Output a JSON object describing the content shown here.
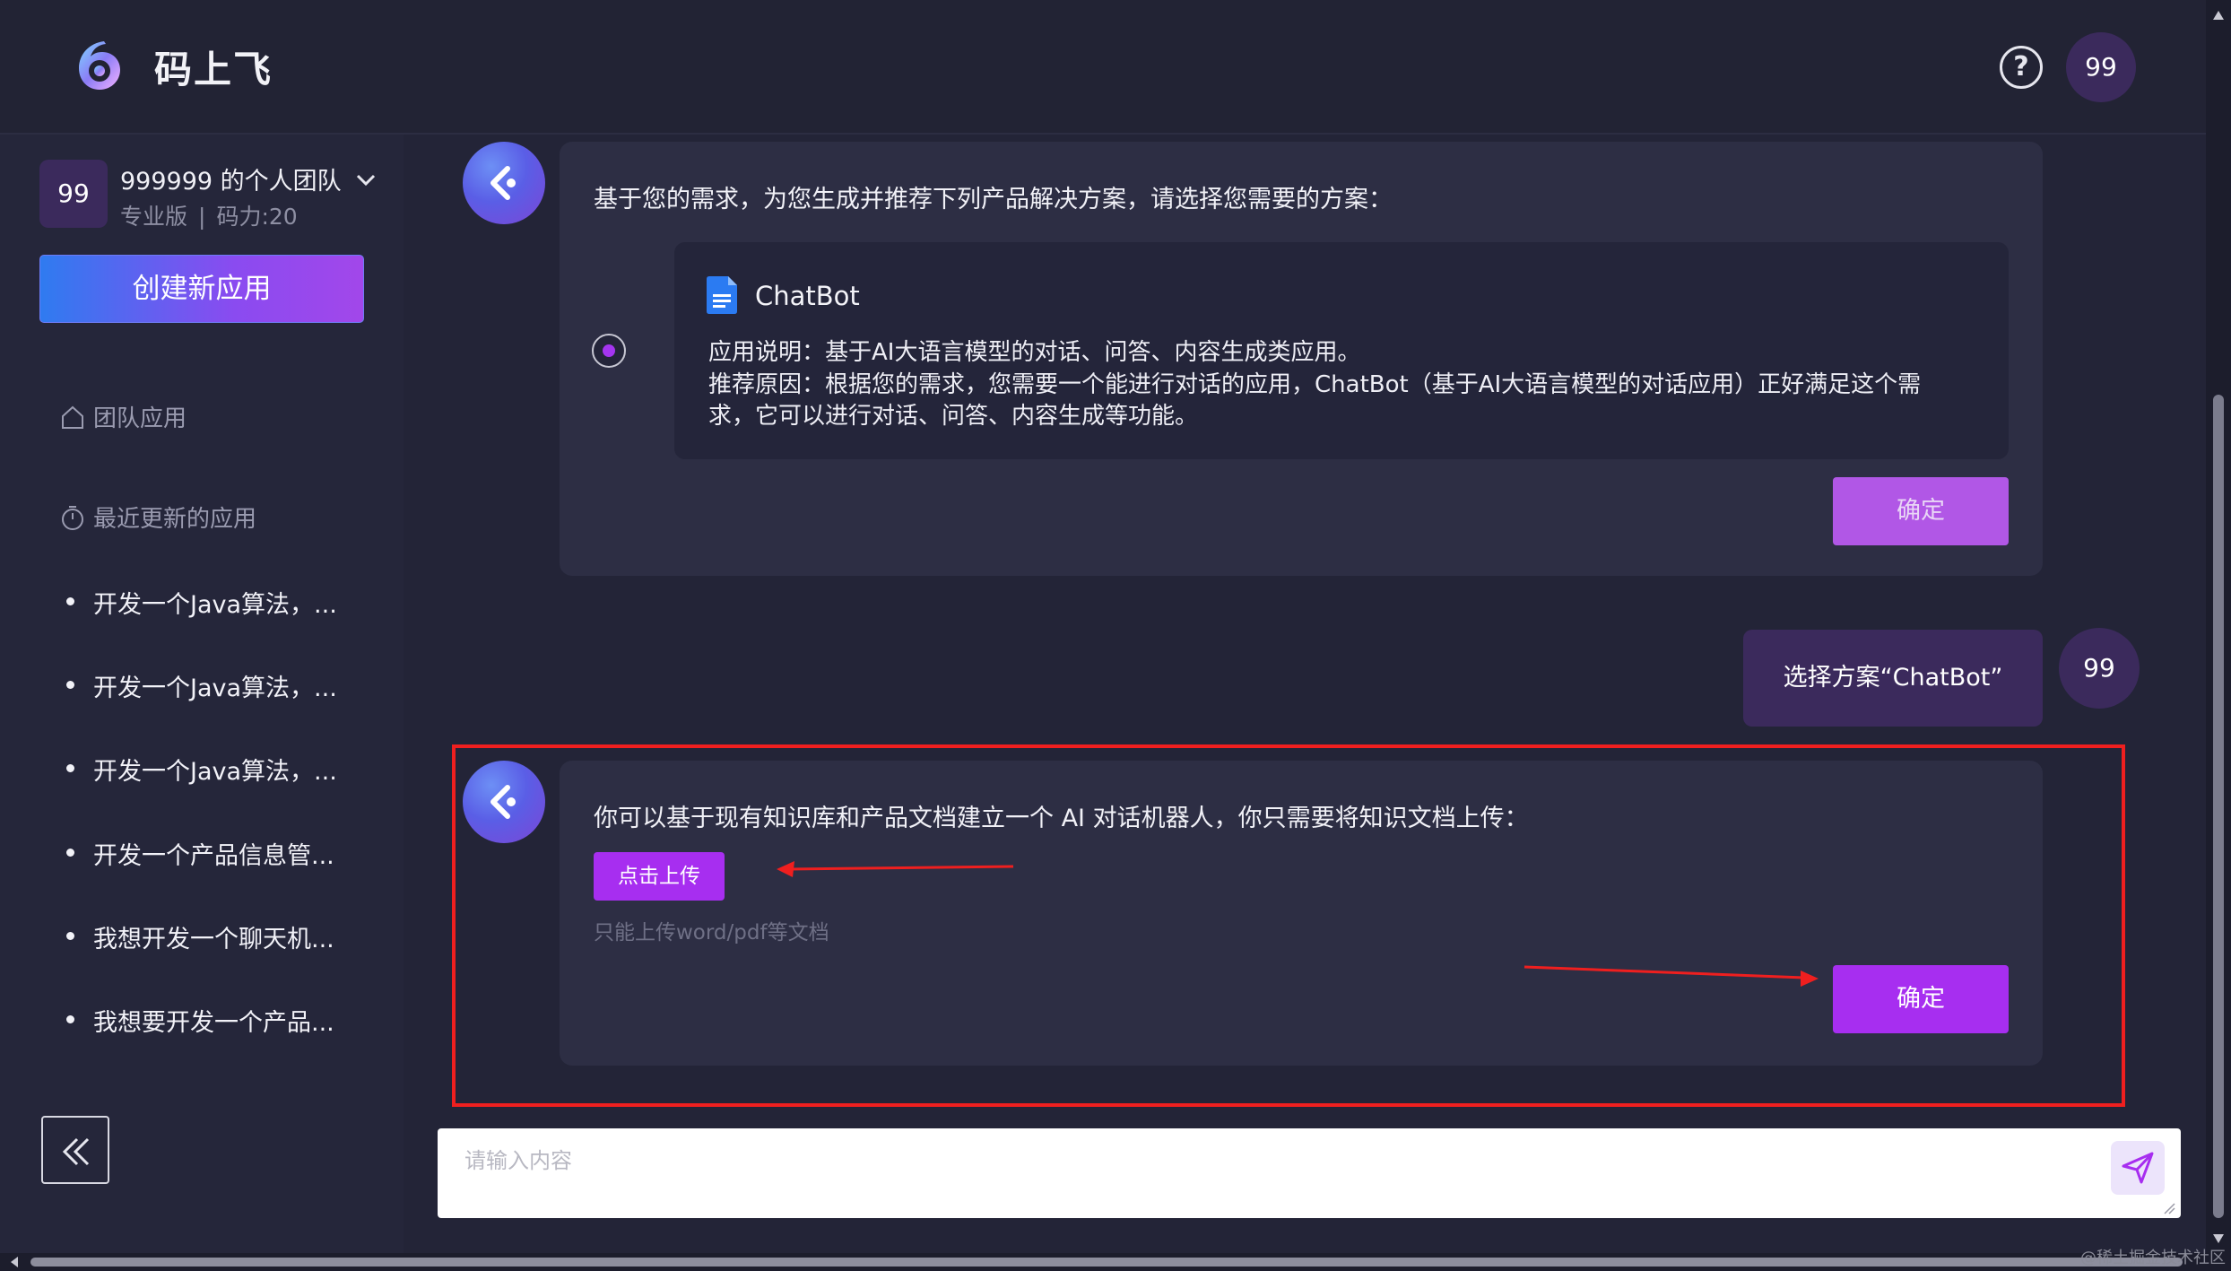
{
  "header": {
    "app_title": "码上飞",
    "help_icon": "question-circle-icon",
    "avatar_label": "99"
  },
  "sidebar": {
    "team": {
      "avatar_label": "99",
      "name": "999999 的个人团队",
      "plan": "专业版",
      "separator": "|",
      "power": "码力:20"
    },
    "create_button": "创建新应用",
    "nav": {
      "team_apps": "团队应用",
      "recent_apps": "最近更新的应用"
    },
    "recent_items": [
      "开发一个Java算法，...",
      "开发一个Java算法，...",
      "开发一个Java算法，...",
      "开发一个产品信息管...",
      "我想开发一个聊天机...",
      "我想要开发一个产品..."
    ]
  },
  "chat": {
    "message1": {
      "intro": "基于您的需求，为您生成并推荐下列产品解决方案，请选择您需要的方案：",
      "option": {
        "title": "ChatBot",
        "desc_line1": "应用说明：基于AI大语言模型的对话、问答、内容生成类应用。",
        "desc_line2": "推荐原因：根据您的需求，您需要一个能进行对话的应用，ChatBot（基于AI大语言模型的对话应用）正好满足这个需",
        "desc_line3": "求，它可以进行对话、问答、内容生成等功能。"
      },
      "confirm": "确定"
    },
    "user_message": {
      "text": "选择方案“ChatBot”",
      "avatar_label": "99"
    },
    "message2": {
      "text": "你可以基于现有知识库和产品文档建立一个 AI 对话机器人，你只需要将知识文档上传：",
      "upload_button": "点击上传",
      "upload_hint": "只能上传word/pdf等文档",
      "confirm": "确定"
    }
  },
  "input": {
    "placeholder": "请输入内容"
  },
  "watermark": "@稀土掘金技术社区",
  "colors": {
    "accent": "#a72ef0",
    "highlight": "#ef1f1f",
    "background": "#232437"
  }
}
